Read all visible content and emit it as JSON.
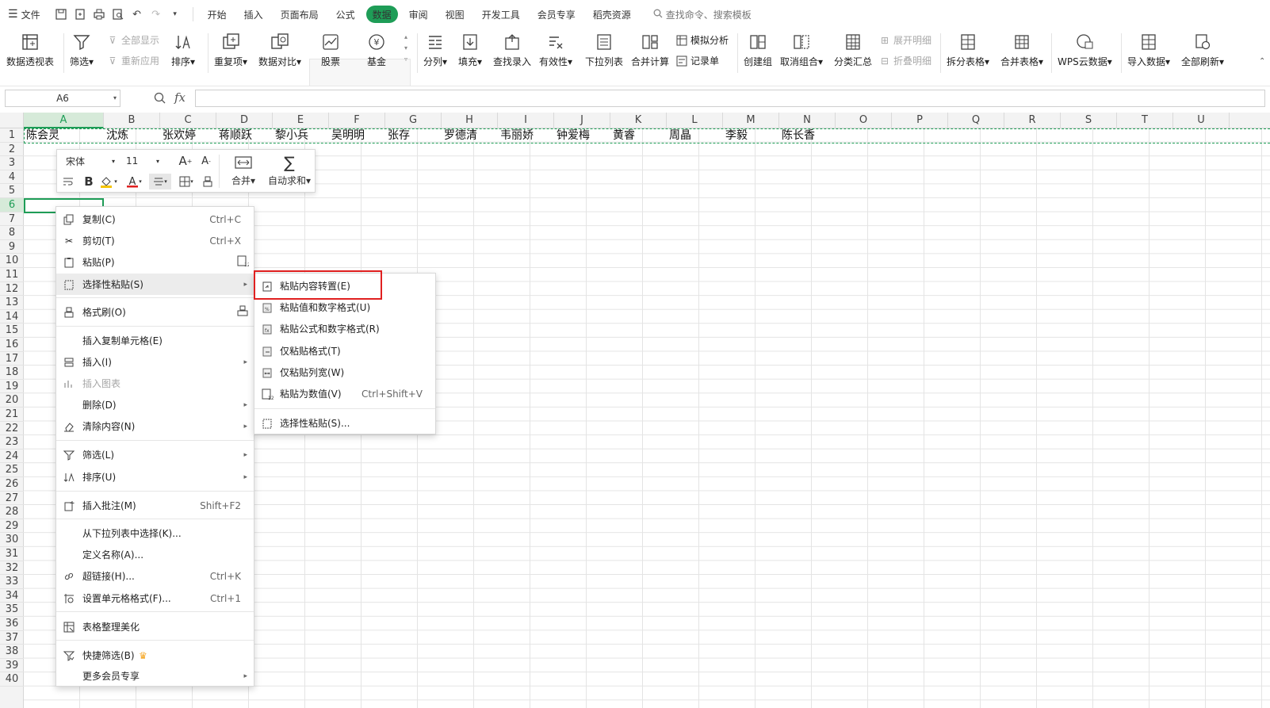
{
  "menubar": {
    "file_label": "文件",
    "tabs": [
      "开始",
      "插入",
      "页面布局",
      "公式",
      "数据",
      "审阅",
      "视图",
      "开发工具",
      "会员专享",
      "稻壳资源"
    ],
    "active_tab": "数据",
    "search_placeholder": "查找命令、搜索模板"
  },
  "ribbon": {
    "pivot": "数据透视表",
    "filter": "筛选",
    "show_all": "全部显示",
    "reapply": "重新应用",
    "sort": "排序",
    "duplicates": "重复项",
    "compare": "数据对比",
    "stock": "股票",
    "fund": "基金",
    "split_col": "分列",
    "fill": "填充",
    "lookup": "查找录入",
    "validity": "有效性",
    "dropdown": "下拉列表",
    "consolidate": "合并计算",
    "whatif": "模拟分析",
    "record_form": "记录单",
    "group": "创建组",
    "ungroup": "取消组合",
    "subtotal": "分类汇总",
    "expand": "展开明细",
    "collapse": "折叠明细",
    "split_table": "拆分表格",
    "merge_table": "合并表格",
    "wps_cloud": "WPS云数据",
    "import": "导入数据",
    "refresh_all": "全部刷新"
  },
  "formula_bar": {
    "cell_ref": "A6",
    "fx": "fx",
    "value": ""
  },
  "grid": {
    "columns": [
      "A",
      "B",
      "C",
      "D",
      "E",
      "F",
      "G",
      "H",
      "I",
      "J",
      "K",
      "L",
      "M",
      "N",
      "O",
      "P",
      "Q",
      "R",
      "S",
      "T",
      "U"
    ],
    "rows": [
      "1",
      "2",
      "3",
      "4",
      "5",
      "6",
      "7",
      "8",
      "9",
      "10",
      "11",
      "12",
      "13",
      "14",
      "15",
      "16",
      "17",
      "18",
      "19",
      "20",
      "21",
      "22",
      "23",
      "24",
      "25",
      "26",
      "27",
      "28",
      "29",
      "30",
      "31",
      "32",
      "33",
      "34",
      "35",
      "36",
      "37",
      "38",
      "39",
      "40"
    ],
    "row1_values": [
      "陈会灵",
      "沈炼",
      "张欢婷",
      "蒋顺跃",
      "黎小兵",
      "吴明明",
      "张存",
      "罗德清",
      "韦丽娇",
      "钟爱梅",
      "黄睿",
      "周晶",
      "李毅",
      "陈长香"
    ]
  },
  "mini_toolbar": {
    "font": "宋体",
    "size": "11",
    "merge": "合并",
    "autosum": "自动求和"
  },
  "context_menu": {
    "copy": {
      "label": "复制(C)",
      "shortcut": "Ctrl+C"
    },
    "cut": {
      "label": "剪切(T)",
      "shortcut": "Ctrl+X"
    },
    "paste": {
      "label": "粘贴(P)"
    },
    "paste_special": {
      "label": "选择性粘贴(S)"
    },
    "format_painter": {
      "label": "格式刷(O)"
    },
    "insert_copied": {
      "label": "插入复制单元格(E)"
    },
    "insert": {
      "label": "插入(I)"
    },
    "insert_chart": {
      "label": "插入图表"
    },
    "delete": {
      "label": "删除(D)"
    },
    "clear": {
      "label": "清除内容(N)"
    },
    "filter": {
      "label": "筛选(L)"
    },
    "sort": {
      "label": "排序(U)"
    },
    "comment": {
      "label": "插入批注(M)",
      "shortcut": "Shift+F2"
    },
    "pick_list": {
      "label": "从下拉列表中选择(K)..."
    },
    "define_name": {
      "label": "定义名称(A)..."
    },
    "hyperlink": {
      "label": "超链接(H)...",
      "shortcut": "Ctrl+K"
    },
    "format_cells": {
      "label": "设置单元格格式(F)...",
      "shortcut": "Ctrl+1"
    },
    "beautify": {
      "label": "表格整理美化"
    },
    "quick_filter": {
      "label": "快捷筛选(B)"
    },
    "more_vip": {
      "label": "更多会员专享"
    }
  },
  "submenu": {
    "transpose": {
      "label": "粘贴内容转置(E)"
    },
    "values_numfmt": {
      "label": "粘贴值和数字格式(U)"
    },
    "formulas_numfmt": {
      "label": "粘贴公式和数字格式(R)"
    },
    "formats_only": {
      "label": "仅粘贴格式(T)"
    },
    "col_width_only": {
      "label": "仅粘贴列宽(W)"
    },
    "as_values": {
      "label": "粘贴为数值(V)",
      "shortcut": "Ctrl+Shift+V"
    },
    "paste_special": {
      "label": "选择性粘贴(S)..."
    }
  },
  "colors": {
    "accent": "#1e9d57",
    "highlight_box": "#e02020",
    "vip_crown": "#f5a623"
  }
}
